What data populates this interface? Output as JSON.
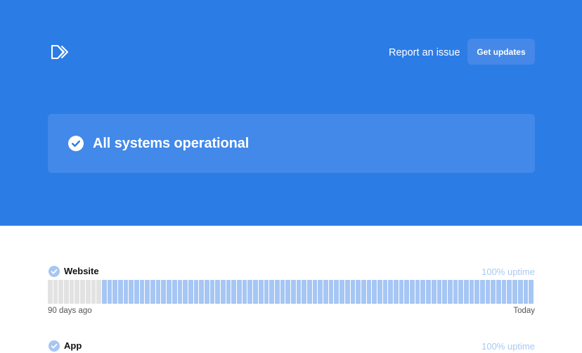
{
  "header": {
    "logo_icon": "fast-forward-logo-icon",
    "report_label": "Report an issue",
    "updates_label": "Get updates"
  },
  "status": {
    "icon": "check-circle-icon",
    "title": "All systems operational"
  },
  "components": [
    {
      "name": "Website",
      "uptime": "100% uptime",
      "start_label": "90 days ago",
      "end_label": "Today",
      "no_data_days": 10,
      "total_days": 90
    },
    {
      "name": "App",
      "uptime": "100% uptime"
    }
  ],
  "colors": {
    "brand": "#2c7ce6",
    "bar_up": "#a6c6f4",
    "bar_no_data": "#e2e2e2",
    "uptime_text": "#a9c8f5"
  }
}
